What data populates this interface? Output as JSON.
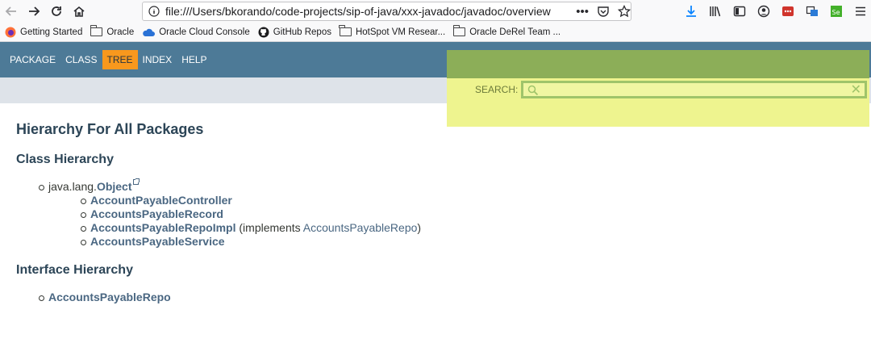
{
  "browser": {
    "url": "file:///Users/bkorando/code-projects/sip-of-java/xxx-javadoc/javadoc/overview",
    "page_actions": [
      "more-icon",
      "pocket-icon",
      "bookmark-star-icon"
    ],
    "bookmarks": [
      {
        "label": "Getting Started",
        "icon": "firefox-icon"
      },
      {
        "label": "Oracle",
        "icon": "folder-icon"
      },
      {
        "label": "Oracle Cloud Console",
        "icon": "cloud-icon"
      },
      {
        "label": "GitHub Repos",
        "icon": "github-icon"
      },
      {
        "label": "HotSpot VM Resear...",
        "icon": "folder-icon"
      },
      {
        "label": "Oracle DeRel Team ...",
        "icon": "folder-icon"
      }
    ]
  },
  "javadoc": {
    "nav": [
      {
        "label": "PACKAGE",
        "active": false
      },
      {
        "label": "CLASS",
        "active": false
      },
      {
        "label": "TREE",
        "active": true
      },
      {
        "label": "INDEX",
        "active": false
      },
      {
        "label": "HELP",
        "active": false
      }
    ],
    "search_label": "SEARCH:",
    "search_value": "",
    "title": "Hierarchy For All Packages",
    "class_hierarchy": {
      "heading": "Class Hierarchy",
      "root_prefix": "java.lang.",
      "root_link": "Object",
      "children": [
        {
          "name": "AccountPayableController",
          "implements": null
        },
        {
          "name": "AccountsPayableRecord",
          "implements": null
        },
        {
          "name": "AccountsPayableRepoImpl",
          "implements_prefix": " (implements ",
          "implements": "AccountsPayableRepo",
          "implements_suffix": ")"
        },
        {
          "name": "AccountsPayableService",
          "implements": null
        }
      ]
    },
    "interface_hierarchy": {
      "heading": "Interface Hierarchy",
      "items": [
        "AccountsPayableRepo"
      ]
    }
  },
  "colors": {
    "nav_bg": "#4d7a97",
    "active_tab": "#f8981d",
    "highlight_top": "#8cae58",
    "highlight_bottom": "#eef48f",
    "link": "#4a6782"
  }
}
